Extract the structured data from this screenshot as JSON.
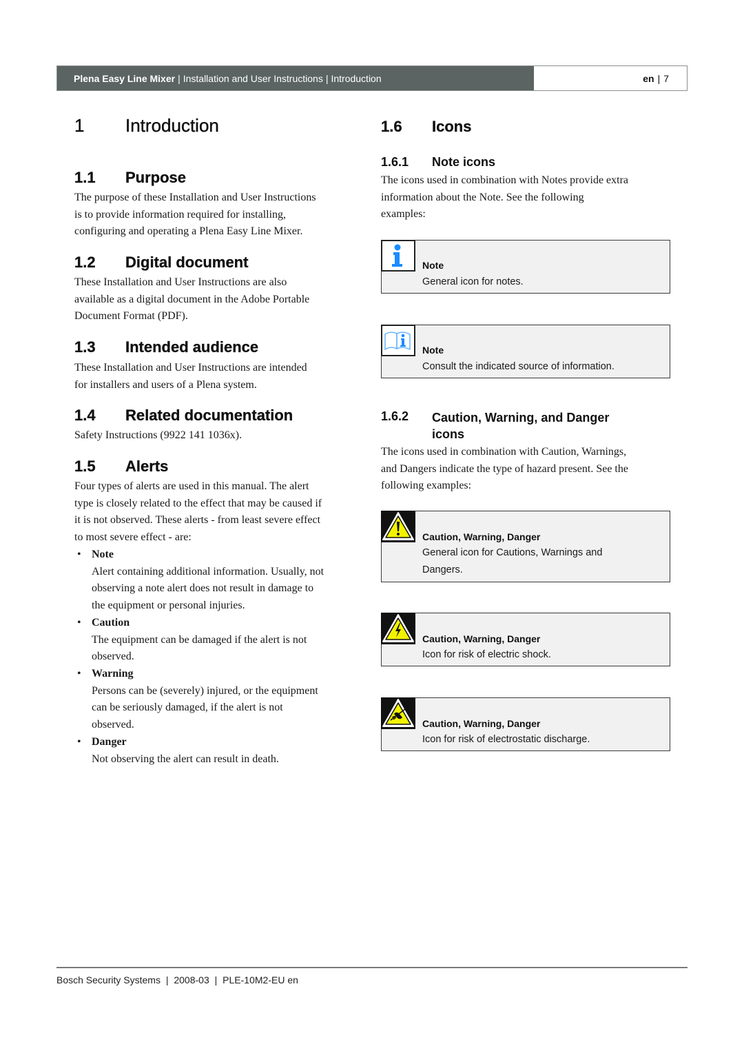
{
  "header": {
    "product": "Plena Easy Line Mixer",
    "document": "Installation and User Instructions",
    "section": "Introduction",
    "separator": "|",
    "language": "en",
    "page": "7"
  },
  "chapter": {
    "number": "1",
    "title": "Introduction"
  },
  "sections": {
    "purpose": {
      "number": "1.1",
      "title": "Purpose",
      "lines": [
        "The purpose of these Installation and User Instructions",
        "is to provide information required for installing,",
        "configuring and operating a Plena Easy Line Mixer."
      ]
    },
    "digital": {
      "number": "1.2",
      "title": "Digital document",
      "lines": [
        "These Installation and User Instructions are also",
        "available as a digital document in the Adobe Portable",
        "Document Format (PDF)."
      ]
    },
    "audience": {
      "number": "1.3",
      "title": "Intended audience",
      "lines": [
        "These Installation and User Instructions are intended",
        "for installers and users of a Plena system."
      ]
    },
    "related": {
      "number": "1.4",
      "title": "Related documentation",
      "lines": [
        "Safety Instructions (9922 141 1036x)."
      ]
    },
    "alerts": {
      "number": "1.5",
      "title": "Alerts",
      "lines": [
        "Four types of alerts are used in this manual. The alert",
        "type is closely related to the effect that may be caused if",
        "it is not observed. These alerts - from least severe effect",
        "to most severe effect - are:"
      ],
      "bullet_char": "•",
      "items": [
        {
          "label": "Note",
          "lines": [
            "Alert containing additional information. Usually, not",
            "observing a note alert does not result in damage to",
            "the equipment or personal injuries."
          ]
        },
        {
          "label": "Caution",
          "lines": [
            "The equipment can be damaged if the alert is not",
            "observed."
          ]
        },
        {
          "label": "Warning",
          "lines": [
            "Persons can be (severely) injured, or the equipment",
            "can be seriously damaged, if the alert is not",
            "observed."
          ]
        },
        {
          "label": "Danger",
          "lines": [
            "Not observing the alert can result in death."
          ]
        }
      ]
    },
    "icons": {
      "number": "1.6",
      "title": "Icons",
      "note_icons": {
        "number": "1.6.1",
        "title": "Note icons",
        "lines": [
          "The icons used in combination with Notes provide extra",
          "information about the Note. See the following",
          "examples:"
        ],
        "boxes": [
          {
            "icon": "info-icon",
            "title": "Note",
            "lines": [
              "General icon for notes."
            ]
          },
          {
            "icon": "book-info-icon",
            "title": "Note",
            "lines": [
              "Consult the indicated source of information."
            ]
          }
        ]
      },
      "hazard_icons": {
        "number": "1.6.2",
        "title_line1": "Caution, Warning, and Danger",
        "title_line2": "icons",
        "lines": [
          "The icons used in combination with Caution, Warnings,",
          "and Dangers indicate the type of hazard present. See the",
          "following examples:"
        ],
        "boxes": [
          {
            "icon": "warning-exclamation-icon",
            "title": "Caution, Warning, Danger",
            "lines": [
              "General icon for Cautions, Warnings and",
              "Dangers."
            ]
          },
          {
            "icon": "electric-shock-icon",
            "title": "Caution, Warning, Danger",
            "lines": [
              "Icon for risk of electric shock."
            ]
          },
          {
            "icon": "electrostatic-discharge-icon",
            "title": "Caution, Warning, Danger",
            "lines": [
              "Icon for risk of electrostatic discharge."
            ]
          }
        ]
      }
    }
  },
  "colors": {
    "header_bg": "#5b6462",
    "box_bg": "#f0f1f0",
    "info_blue": "#1a8cff",
    "hazard_yellow": "#f2f200"
  },
  "footer": {
    "company": "Bosch Security Systems",
    "date": "2008-03",
    "doc_id": "PLE-10M2-EU en",
    "separator": "|"
  }
}
